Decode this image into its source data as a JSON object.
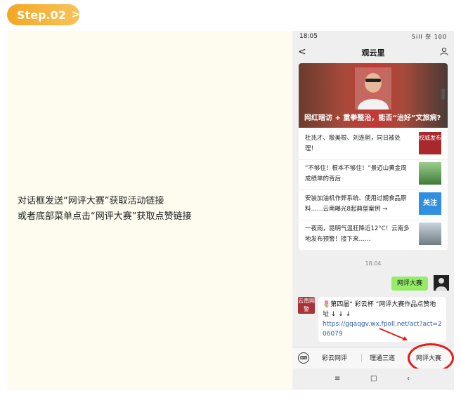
{
  "step": {
    "label": "Step.02",
    "chevron": ">"
  },
  "instruction": {
    "line1": "对话框发送“网评大赛”获取活动链接",
    "line2": "或者底部菜单点击“网评大赛”获取点赞链接"
  },
  "phone": {
    "status": {
      "time": "18:05",
      "icons": "5ill 奈 100"
    },
    "header": {
      "back": "<",
      "title": "观云里"
    },
    "hero": {
      "caption": "网红暗访 + 重拳整治，能否“治好”文旅病?"
    },
    "news": [
      {
        "text": "杜兆才、殷美根、刘连舸，同日被处理！",
        "thumb_text": "权威发布"
      },
      {
        "text": "“不够住！根本不够住！”景迈山黄金周成绩单的背后",
        "thumb_text": ""
      },
      {
        "text": "安装加油机作弊系统、使用过期食品原料……云南曝光8起典型案例 →",
        "thumb_text": "关注"
      },
      {
        "text": "一夜雨，昆明气温狂降近12°C！云南多地发布预警！接下来……",
        "thumb_text": ""
      }
    ],
    "timestamp": "18:04",
    "outgoing_message": "网评大赛",
    "incoming": {
      "avatar_text": "云南网警",
      "line1": "🌷第四届“ 彩云杯 ”网评大赛作品点赞地址 ↓ ↓ ↓",
      "link": "https://gqaqgv.wx.fpoll.net/act?act=206079"
    },
    "menu": {
      "keyboard": "⌨",
      "items": [
        "彩云网评",
        "理通三迤",
        "网评大赛"
      ]
    },
    "sys_nav": {
      "menu": "≡",
      "home": "□",
      "back": "‹"
    }
  },
  "colors": {
    "badge": "#f5a623",
    "panel": "#fdfcee",
    "bubble_out": "#95ec69",
    "link": "#2a5ba8",
    "highlight": "#e0201a"
  }
}
